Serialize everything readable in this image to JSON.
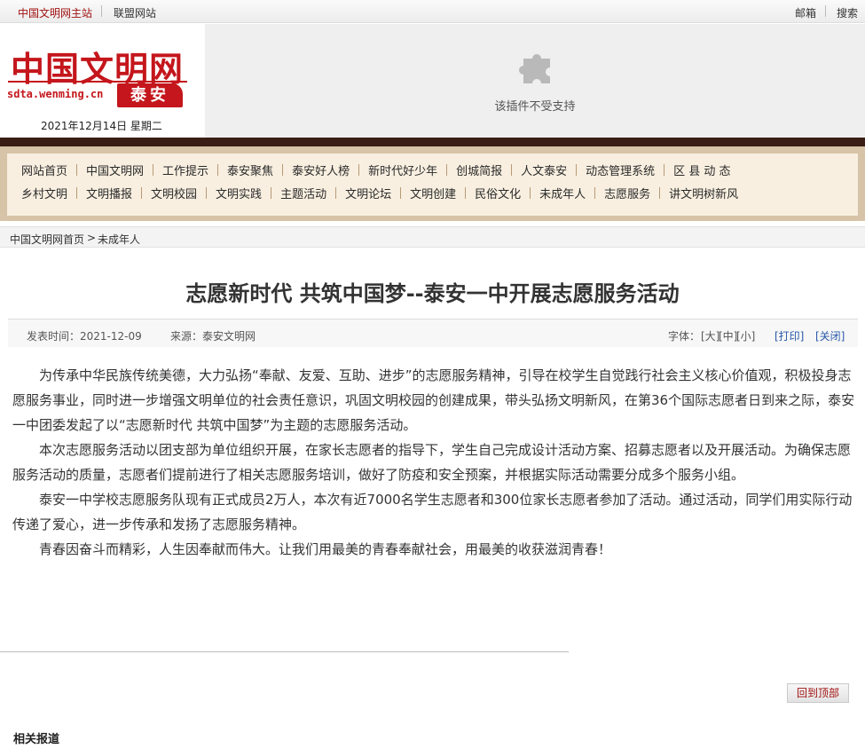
{
  "topbar": {
    "main_site": "中国文明网主站",
    "union_sites": "联盟网站",
    "mail": "邮箱",
    "search": "搜索"
  },
  "header": {
    "logo_name": "中国文明网",
    "logo_url": "sdta.wenming.cn",
    "logo_city": "泰安",
    "date": "2021年12月14日 星期二",
    "plugin_message": "该插件不受支持",
    "plugin_icon": "puzzle-icon"
  },
  "nav": {
    "row1": [
      "网站首页",
      "中国文明网",
      "工作提示",
      "泰安聚焦",
      "泰安好人榜",
      "新时代好少年",
      "创城简报",
      "人文泰安",
      "动态管理系统",
      "区 县 动 态"
    ],
    "row2": [
      "乡村文明",
      "文明播报",
      "文明校园",
      "文明实践",
      "主题活动",
      "文明论坛",
      "文明创建",
      "民俗文化",
      "未成年人",
      "志愿服务",
      "讲文明树新风"
    ]
  },
  "breadcrumb": {
    "home": "中国文明网首页",
    "separator": ">",
    "current": "未成年人"
  },
  "article": {
    "title": "志愿新时代 共筑中国梦--泰安一中开展志愿服务活动",
    "publish_time": "发表时间：2021-12-09",
    "source": "来源：泰安文明网",
    "font_size_label": "字体：",
    "font_large": "[大]",
    "font_medium": "[中]",
    "font_small": "[小]",
    "print": "[打印]",
    "close": "[关闭]",
    "paragraphs": [
      "为传承中华民族传统美德，大力弘扬“奉献、友爱、互助、进步”的志愿服务精神，引导在校学生自觉践行社会主义核心价值观，积极投身志愿服务事业，同时进一步增强文明单位的社会责任意识，巩固文明校园的创建成果，带头弘扬文明新风，在第36个国际志愿者日到来之际，泰安一中团委发起了以“志愿新时代 共筑中国梦”为主题的志愿服务活动。",
      "本次志愿服务活动以团支部为单位组织开展，在家长志愿者的指导下，学生自己完成设计活动方案、招募志愿者以及开展活动。为确保志愿服务活动的质量，志愿者们提前进行了相关志愿服务培训，做好了防疫和安全预案，并根据实际活动需要分成多个服务小组。",
      "泰安一中学校志愿服务队现有正式成员2万人，本次有近7000名学生志愿者和300位家长志愿者参加了活动。通过活动，同学们用实际行动传递了爱心，进一步传承和发扬了志愿服务精神。",
      "青春因奋斗而精彩，人生因奉献而伟大。让我们用最美的青春奉献社会，用最美的收获滋润青春！"
    ]
  },
  "back_to_top": "回到顶部",
  "related_title": "相关报道",
  "colors": {
    "brand_red": "#c4161c",
    "nav_bg": "#f8efe0",
    "nav_frame": "#d7c3a7",
    "dark_band": "#3a1e16",
    "link_blue": "#2a58a8"
  }
}
